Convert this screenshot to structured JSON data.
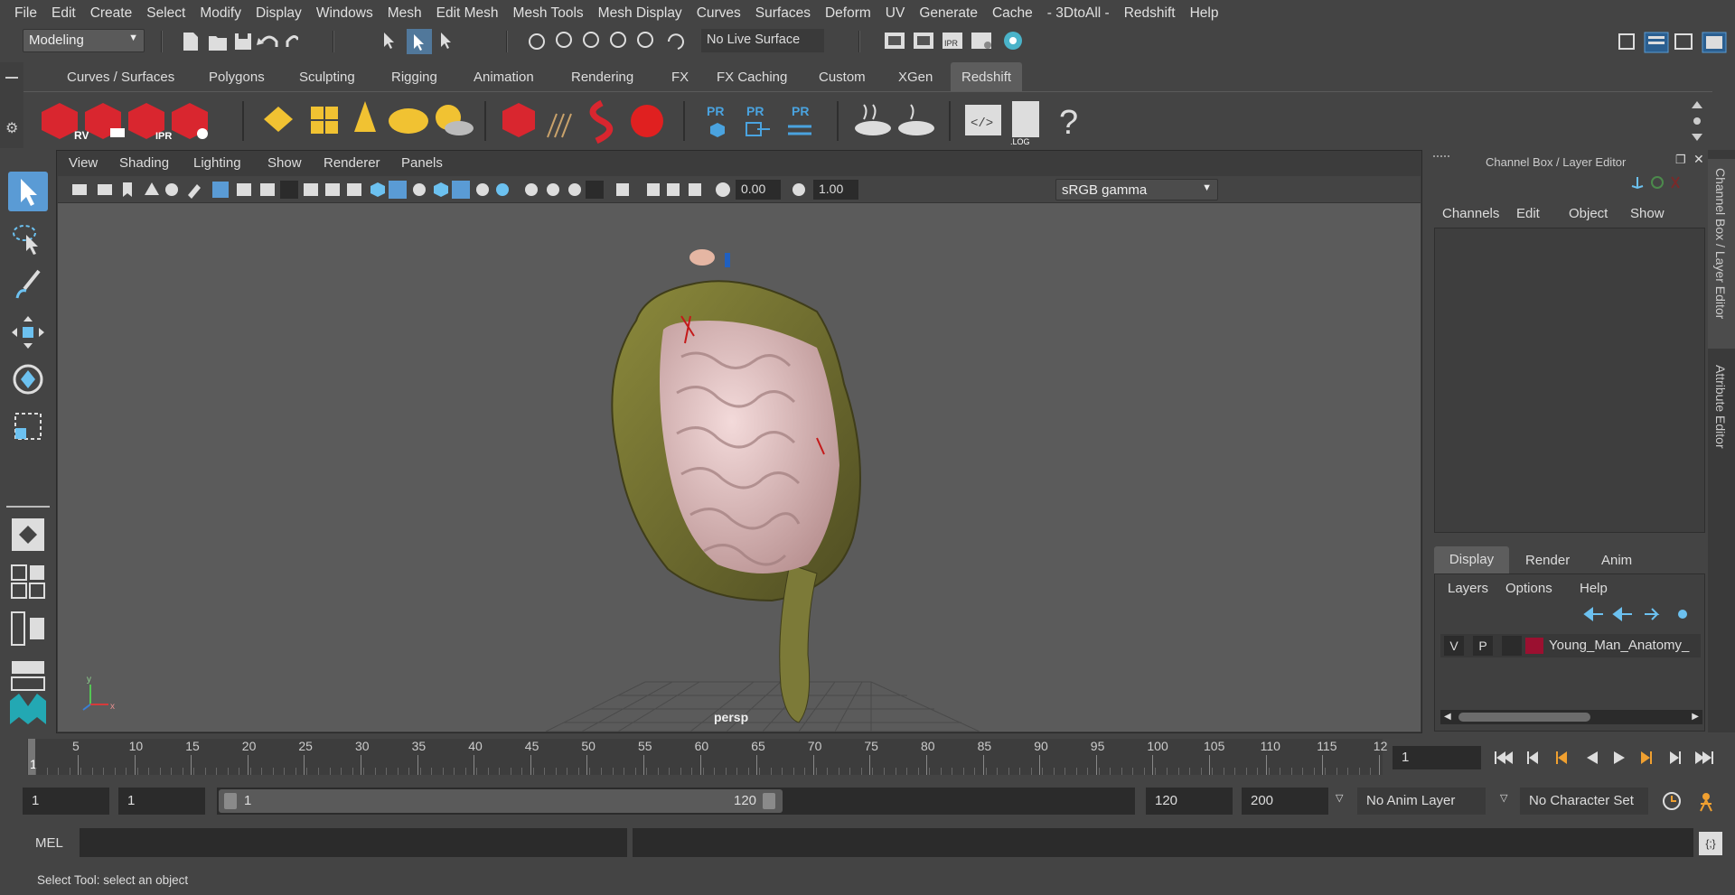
{
  "menu": [
    "File",
    "Edit",
    "Create",
    "Select",
    "Modify",
    "Display",
    "Windows",
    "Mesh",
    "Edit Mesh",
    "Mesh Tools",
    "Mesh Display",
    "Curves",
    "Surfaces",
    "Deform",
    "UV",
    "Generate",
    "Cache",
    "- 3DtoAll -",
    "Redshift",
    "Help"
  ],
  "status": {
    "workspace": "Modeling",
    "live_surface": "No Live Surface"
  },
  "shelf_tabs": [
    "Curves / Surfaces",
    "Polygons",
    "Sculpting",
    "Rigging",
    "Animation",
    "Rendering",
    "FX",
    "FX Caching",
    "Custom",
    "XGen",
    "Redshift"
  ],
  "shelf_active": "Redshift",
  "shelf_icons": {
    "rv": "RV",
    "ipr": "IPR",
    "pr": "PR",
    "log": ".LOG",
    "help": "?"
  },
  "viewport": {
    "menu": [
      "View",
      "Shading",
      "Lighting",
      "Show",
      "Renderer",
      "Panels"
    ],
    "exposure": "0.00",
    "gamma": "1.00",
    "color_space": "sRGB gamma",
    "camera_label": "persp"
  },
  "channel_box": {
    "title": "Channel Box / Layer Editor",
    "menu": [
      "Channels",
      "Edit",
      "Object",
      "Show"
    ],
    "layer_tabs": [
      "Display",
      "Render",
      "Anim"
    ],
    "layer_menu": [
      "Layers",
      "Options",
      "Help"
    ],
    "layer": {
      "v": "V",
      "p": "P",
      "name": "Young_Man_Anatomy_",
      "color": "#9b1030"
    }
  },
  "side_tabs": [
    "Channel Box / Layer Editor",
    "Attribute Editor"
  ],
  "timeline": {
    "ticks": [
      5,
      10,
      15,
      20,
      25,
      30,
      35,
      40,
      45,
      50,
      55,
      60,
      65,
      70,
      75,
      80,
      85,
      90,
      95,
      100,
      105,
      110,
      115,
      "12"
    ],
    "current": "1",
    "current_frame_field": "1"
  },
  "range": {
    "start": "1",
    "anim_start": "1",
    "slider_start": "1",
    "slider_end": "120",
    "end": "120",
    "anim_end": "200",
    "anim_layer": "No Anim Layer",
    "character_set": "No Character Set"
  },
  "command": {
    "lang": "MEL"
  },
  "help_line": "Select Tool: select an object",
  "colors": {
    "accent": "#5a9bd5",
    "redshift_red": "#d9262f",
    "shelf_yellow": "#f1c232"
  }
}
